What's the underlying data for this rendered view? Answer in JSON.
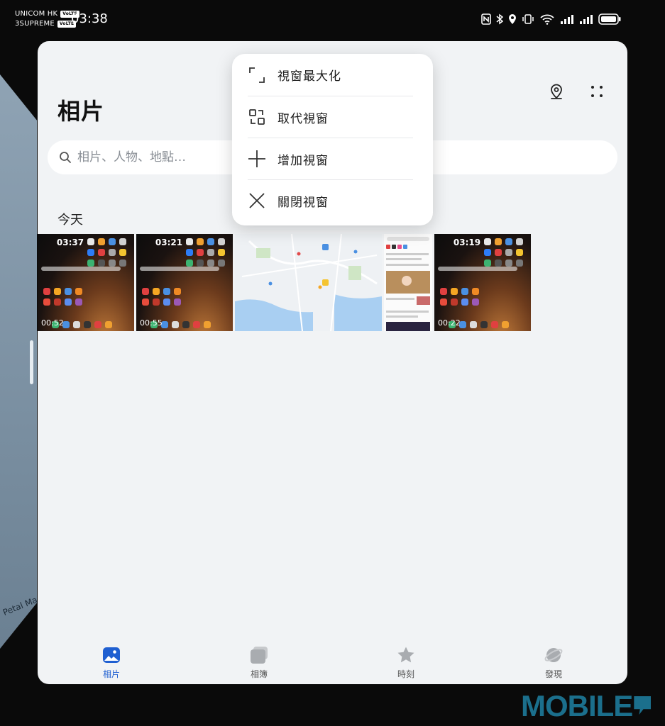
{
  "status_bar": {
    "carrier_1": "UNICOM HK",
    "carrier_1_net": "VoLTE",
    "carrier_2": "3SUPREME",
    "carrier_2_net": "VoLTE",
    "time": "03:38",
    "icons": [
      "nfc-icon",
      "bluetooth-icon",
      "location-icon",
      "vibrate-icon",
      "wifi-icon",
      "signal-icon",
      "signal-icon",
      "battery-icon"
    ]
  },
  "background_app": {
    "label": "Petal Ma"
  },
  "header": {
    "title": "相片",
    "icons": [
      "map-pin-icon",
      "more-dots-icon"
    ]
  },
  "search": {
    "placeholder": "相片、人物、地點…"
  },
  "section": {
    "title": "今天"
  },
  "thumbnails": [
    {
      "kind": "home",
      "time": "03:37",
      "duration": "00:52"
    },
    {
      "kind": "home",
      "time": "03:21",
      "duration": "00:55"
    },
    {
      "kind": "map"
    },
    {
      "kind": "web"
    },
    {
      "kind": "home",
      "time": "03:19",
      "duration": "00:22"
    }
  ],
  "window_menu": {
    "items": [
      {
        "label": "視窗最大化",
        "icon": "maximize-icon"
      },
      {
        "label": "取代視窗",
        "icon": "replace-window-icon"
      },
      {
        "label": "增加視窗",
        "icon": "add-icon"
      },
      {
        "label": "關閉視窗",
        "icon": "close-icon"
      }
    ]
  },
  "bottom_nav": {
    "items": [
      {
        "label": "相片",
        "icon": "photos-icon",
        "active": true
      },
      {
        "label": "相簿",
        "icon": "albums-icon",
        "active": false
      },
      {
        "label": "時刻",
        "icon": "star-icon",
        "active": false
      },
      {
        "label": "發現",
        "icon": "discover-icon",
        "active": false
      }
    ]
  },
  "colors": {
    "accent": "#1f5fd1",
    "window_bg": "#f1f3f5",
    "watermark": "#1b6f8c"
  },
  "watermark": {
    "text": "MOBILE"
  }
}
